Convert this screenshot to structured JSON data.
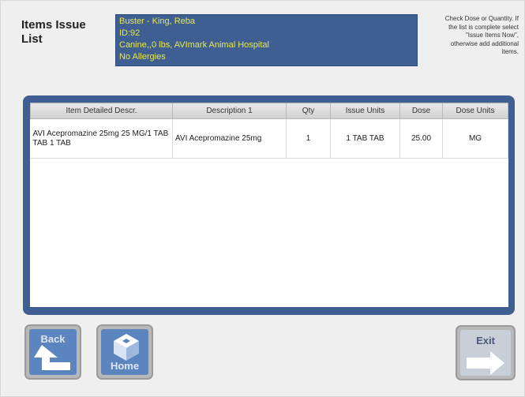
{
  "header": {
    "title": "Items Issue List"
  },
  "patient": {
    "lines": [
      "Buster - King, Reba",
      "ID:92",
      "Canine,,0 lbs, AVImark Animal Hospital",
      "No Allergies"
    ]
  },
  "instructions": {
    "text": "Check Dose or Quantity. If the list is complete select \"Issue Items Now\", otherwise add additional items."
  },
  "table": {
    "columns": [
      "Item Detailed Descr.",
      "Description 1",
      "Qty",
      "Issue Units",
      "Dose",
      "Dose Units"
    ],
    "rows": [
      {
        "item_detailed_descr": "AVI Acepromazine 25mg 25 MG/1 TAB TAB 1 TAB",
        "description_1": "AVI Acepromazine 25mg",
        "qty": "1",
        "issue_units": "1 TAB TAB",
        "dose": "25.00",
        "dose_units": "MG"
      }
    ]
  },
  "buttons": {
    "back": "Back",
    "home": "Home",
    "exit": "Exit"
  },
  "colors": {
    "panel_blue": "#3f5f93",
    "patient_text": "#e8e84a",
    "button_blue": "#5c84bf",
    "button_frame": "#b8b8b8"
  },
  "icons": {
    "back": "back-arrow-icon",
    "home": "home-cube-icon",
    "exit": "exit-arrow-icon"
  }
}
